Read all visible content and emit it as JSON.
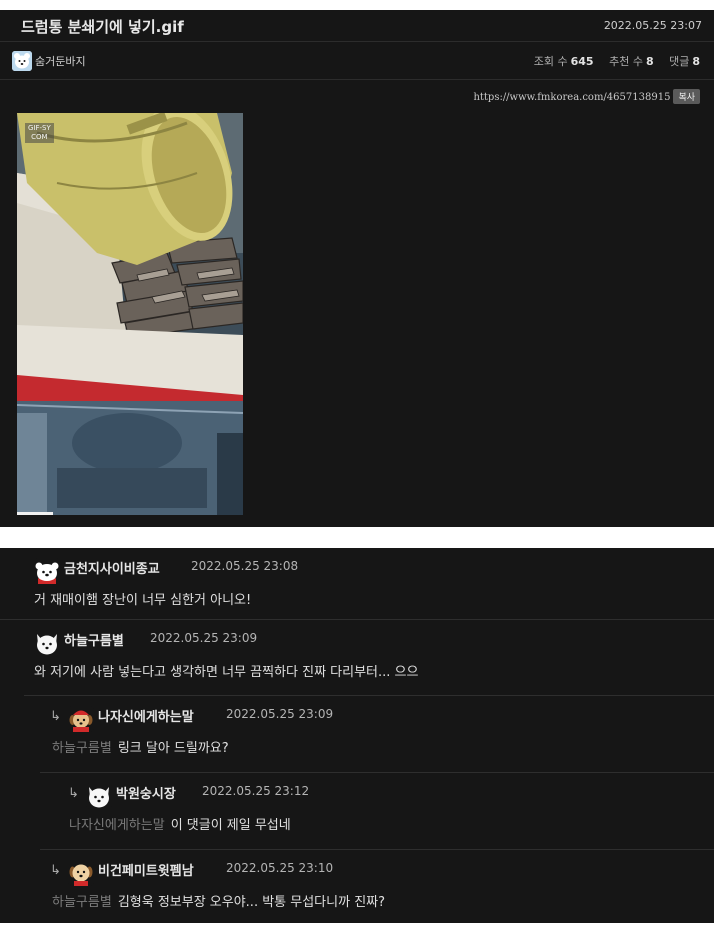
{
  "post": {
    "title": "드럼통 분쇄기에 넣기.gif",
    "date": "2022.05.25 23:07",
    "author": "숨거둔바지",
    "stats": {
      "views_label": "조회 수",
      "views": "645",
      "votes_label": "추천 수",
      "votes": "8",
      "comments_label": "댓글",
      "comments": "8"
    },
    "url": "https://www.fmkorea.com/4657138915",
    "copy_label": "복사",
    "gif": {
      "watermark_line1": "GIF-SY",
      "watermark_line2": "COM",
      "progress_fraction": 0.16,
      "colors": {
        "barrel": "#c9c06a",
        "red_band": "#c42a2f",
        "frame_blue": "#4b6275"
      }
    }
  },
  "comments": [
    {
      "author": "금천지사이비종교",
      "date": "2022.05.25 23:08",
      "mention": "",
      "text": "거 재매이햄 장난이 너무 심한거 아니오!",
      "depth": 0,
      "avatar": "polar-bear-santa-icon"
    },
    {
      "author": "하늘구름별",
      "date": "2022.05.25 23:09",
      "mention": "",
      "text": "와 저기에 사람 넣는다고 생각하면 너무 끔찍하다 진짜 다리부터... 으으",
      "depth": 0,
      "avatar": "white-dog-icon"
    },
    {
      "author": "나자신에게하는말",
      "date": "2022.05.25 23:09",
      "mention": "하늘구름별",
      "text": "링크 달아 드릴까요?",
      "depth": 1,
      "avatar": "puppy-santa-icon"
    },
    {
      "author": "박원숭시장",
      "date": "2022.05.25 23:12",
      "mention": "나자신에게하는말",
      "text": "이 댓글이 제일 무섭네",
      "depth": 2,
      "avatar": "white-dog-icon"
    },
    {
      "author": "비건페미트윗펨남",
      "date": "2022.05.25 23:10",
      "mention": "하늘구름별",
      "text": "김형욱 정보부장 오우야... 박통 무섭다니까 진짜?",
      "depth": 1,
      "avatar": "puppy-icon"
    }
  ]
}
